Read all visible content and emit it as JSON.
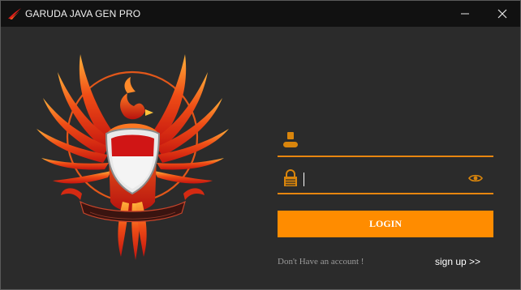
{
  "window": {
    "title": "GARUDA JAVA GEN PRO",
    "minimize_glyph": "─",
    "close_glyph": "✕"
  },
  "logo": {
    "description_icon": "garuda-eagle-logo",
    "banner_text": "BHINNEKA TUNGGAL IKA"
  },
  "login_form": {
    "username": {
      "icon": "user-icon",
      "value": "",
      "placeholder": ""
    },
    "password": {
      "icon": "lock-icon",
      "value": "",
      "placeholder": "",
      "toggle_icon": "eye-icon"
    },
    "login_label": "LOGIN",
    "no_account_text": "Don't Have an account !",
    "signup_label": "sign up >>"
  },
  "colors": {
    "accent": "#ff8c00",
    "underline": "#e8860f",
    "background": "#2b2b2b",
    "titlebar": "#111111",
    "icon_orange": "#d9850c"
  }
}
